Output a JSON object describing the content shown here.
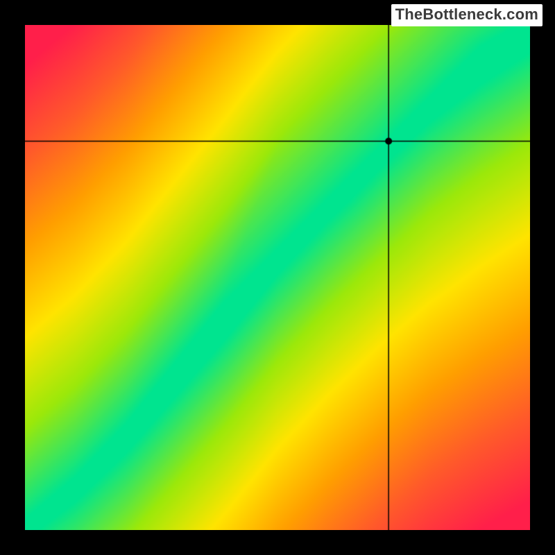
{
  "watermark": "TheBottleneck.com",
  "chart_data": {
    "type": "heatmap",
    "title": "",
    "xlabel": "",
    "ylabel": "",
    "xlim": [
      0,
      1
    ],
    "ylim": [
      0,
      1
    ],
    "crosshair": {
      "x": 0.72,
      "y": 0.77
    },
    "marker": {
      "x": 0.72,
      "y": 0.77
    },
    "ridge": {
      "description": "Optimal (green) band along a slightly super-linear diagonal from bottom-left to upper-right",
      "points": [
        {
          "x": 0.0,
          "y": 0.0
        },
        {
          "x": 0.1,
          "y": 0.08
        },
        {
          "x": 0.2,
          "y": 0.18
        },
        {
          "x": 0.3,
          "y": 0.3
        },
        {
          "x": 0.4,
          "y": 0.42
        },
        {
          "x": 0.5,
          "y": 0.55
        },
        {
          "x": 0.6,
          "y": 0.66
        },
        {
          "x": 0.7,
          "y": 0.76
        },
        {
          "x": 0.8,
          "y": 0.85
        },
        {
          "x": 0.9,
          "y": 0.92
        },
        {
          "x": 1.0,
          "y": 0.98
        }
      ],
      "half_width": 0.06
    },
    "color_stops": [
      {
        "t": 0.0,
        "color": "#00e48f"
      },
      {
        "t": 0.2,
        "color": "#9be80a"
      },
      {
        "t": 0.4,
        "color": "#ffe400"
      },
      {
        "t": 0.6,
        "color": "#ff9f00"
      },
      {
        "t": 0.8,
        "color": "#ff5a2a"
      },
      {
        "t": 1.0,
        "color": "#ff1f4a"
      }
    ]
  }
}
